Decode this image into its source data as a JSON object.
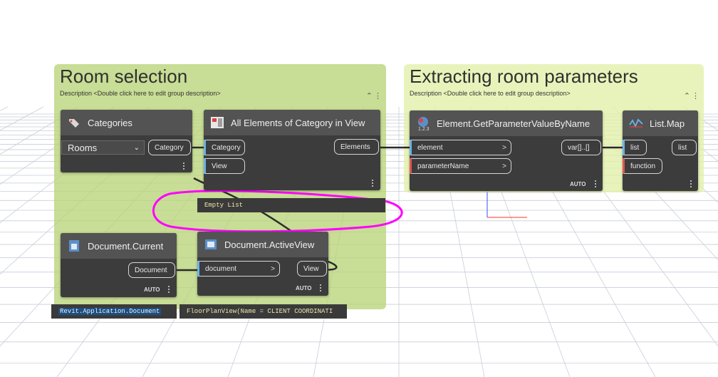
{
  "groups": [
    {
      "title": "Room selection",
      "description": "Description <Double click here to edit group description>",
      "color": "#b8d477"
    },
    {
      "title": "Extracting room parameters",
      "description": "Description <Double click here to edit group description>",
      "color": "#e2f0a8"
    }
  ],
  "nodes": {
    "categories": {
      "title": "Categories",
      "dropdown_value": "Rooms",
      "output": "Category"
    },
    "all_elements": {
      "title": "All Elements of Category in View",
      "inputs": [
        "Category",
        "View"
      ],
      "output": "Elements",
      "preview": "Empty List"
    },
    "document_current": {
      "title": "Document.Current",
      "output": "Document",
      "lacing": "AUTO",
      "preview": "Revit.Application.Document"
    },
    "document_activeview": {
      "title": "Document.ActiveView",
      "input": "document",
      "output": "View",
      "lacing": "AUTO",
      "preview": "FloorPlanView(Name = CLIENT COORDINATI"
    },
    "get_param": {
      "title": "Element.GetParameterValueByName",
      "inputs": [
        "element",
        "parameterName"
      ],
      "output": "var[]..[]",
      "lacing": "AUTO",
      "icon_badge": "1.2.3"
    },
    "list_map": {
      "title": "List.Map",
      "inputs": [
        "list",
        "function"
      ],
      "output": "list"
    }
  },
  "colors": {
    "connector_blue": "#6ab3e8",
    "connector_red": "#e05555",
    "annotation_magenta": "#ff00ff",
    "node_body": "#3c3c3c",
    "node_header": "#535353"
  }
}
